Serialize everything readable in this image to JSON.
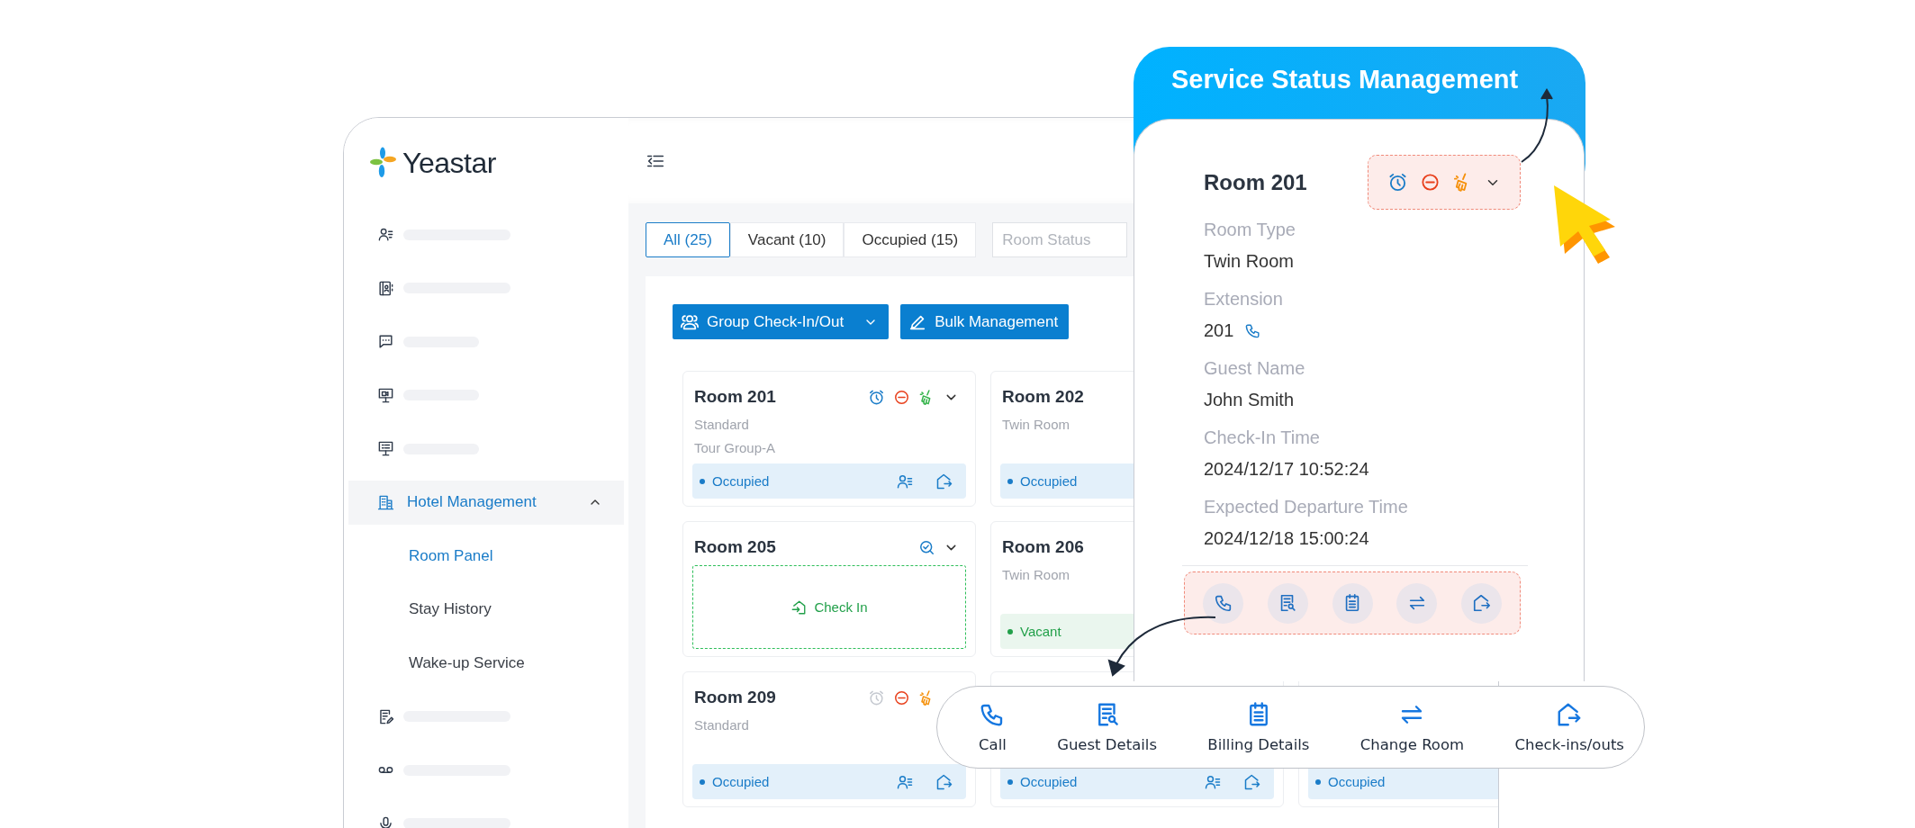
{
  "banner": {
    "title": "Service Status Management"
  },
  "sidebar": {
    "logo": "Yeastar",
    "items": [
      {
        "kind": "placeholder"
      },
      {
        "kind": "placeholder"
      },
      {
        "kind": "placeholder"
      },
      {
        "kind": "placeholder"
      },
      {
        "kind": "placeholder"
      },
      {
        "kind": "group",
        "label": "Hotel Management",
        "selected": true,
        "expanded": true,
        "children": [
          {
            "label": "Room Panel",
            "selected": true
          },
          {
            "label": "Stay History",
            "selected": false
          },
          {
            "label": "Wake-up Service",
            "selected": false
          }
        ]
      },
      {
        "kind": "placeholder"
      },
      {
        "kind": "placeholder"
      },
      {
        "kind": "placeholder"
      }
    ]
  },
  "tabs": [
    {
      "label": "All (25)",
      "selected": true
    },
    {
      "label": "Vacant (10)",
      "selected": false
    },
    {
      "label": "Occupied (15)",
      "selected": false
    }
  ],
  "room_status_filter": {
    "placeholder": "Room Status"
  },
  "buttons": [
    {
      "kind": "group",
      "label": "Group Check-In/Out",
      "dropdown": true
    },
    {
      "kind": "bulk",
      "label": "Bulk Management"
    }
  ],
  "card_rows": [
    [
      {
        "title": "Room 201",
        "details": [
          "Standard",
          "Tour Group-A"
        ],
        "service_icons": [
          {
            "kind": "alarm",
            "color": "#1a7cc8"
          },
          {
            "kind": "dnd",
            "color": "#e8401c"
          },
          {
            "kind": "cleaning",
            "color": "#34b34a"
          }
        ],
        "menu": true,
        "status": {
          "kind": "occupied",
          "label": "Occupied"
        },
        "guest_actions": true
      },
      {
        "title": "Room 202",
        "details": [
          "Twin Room"
        ],
        "status": {
          "kind": "occupied",
          "label": "Occupied"
        }
      }
    ],
    [
      {
        "title": "Room 205",
        "service_icons": [
          {
            "kind": "inspected",
            "color": "#1a7cc8"
          }
        ],
        "menu": true,
        "status": {
          "kind": "check_in",
          "label": "Check In"
        }
      },
      {
        "title": "Room 206",
        "details": [
          "Twin Room"
        ],
        "status": {
          "kind": "vacant",
          "label": "Vacant"
        }
      }
    ],
    [
      {
        "title": "Room 209",
        "details": [
          "Standard"
        ],
        "service_icons": [
          {
            "kind": "alarm",
            "color": "#c5c9d0"
          },
          {
            "kind": "dnd",
            "color": "#e8401c"
          },
          {
            "kind": "cleaning",
            "color": "#f5900a"
          }
        ],
        "status": {
          "kind": "occupied",
          "label": "Occupied"
        },
        "guest_actions": true
      },
      {
        "status": {
          "kind": "occupied",
          "label": "Occupied"
        },
        "guest_actions": true
      },
      {
        "status": {
          "kind": "occupied",
          "label": "Occupied"
        }
      }
    ]
  ],
  "detail": {
    "title": "Room 201",
    "service_icons": [
      {
        "kind": "alarm",
        "color": "#1a7cc8"
      },
      {
        "kind": "dnd",
        "color": "#e8401c"
      },
      {
        "kind": "cleaning",
        "color": "#f5900a"
      }
    ],
    "menu": true,
    "fields": [
      {
        "label": "Room Type",
        "value": "Twin Room"
      },
      {
        "label": "Extension",
        "value": "201",
        "callable": true
      },
      {
        "label": "Guest Name",
        "value": "John Smith"
      },
      {
        "label": "Check-In Time",
        "value": "2024/12/17 10:52:24"
      },
      {
        "label": "Expected Departure Time",
        "value": "2024/12/18 15:00:24"
      }
    ],
    "actions": [
      {
        "kind": "call"
      },
      {
        "kind": "guest_details"
      },
      {
        "kind": "billing"
      },
      {
        "kind": "change_room"
      },
      {
        "kind": "check_out"
      }
    ]
  },
  "action_bar": {
    "items": [
      {
        "kind": "call",
        "label": "Call"
      },
      {
        "kind": "guest_details",
        "label": "Guest Details"
      },
      {
        "kind": "billing",
        "label": "Billing Details"
      },
      {
        "kind": "change_room",
        "label": "Change Room"
      },
      {
        "kind": "check_out",
        "label": "Check-ins/outs"
      }
    ]
  }
}
